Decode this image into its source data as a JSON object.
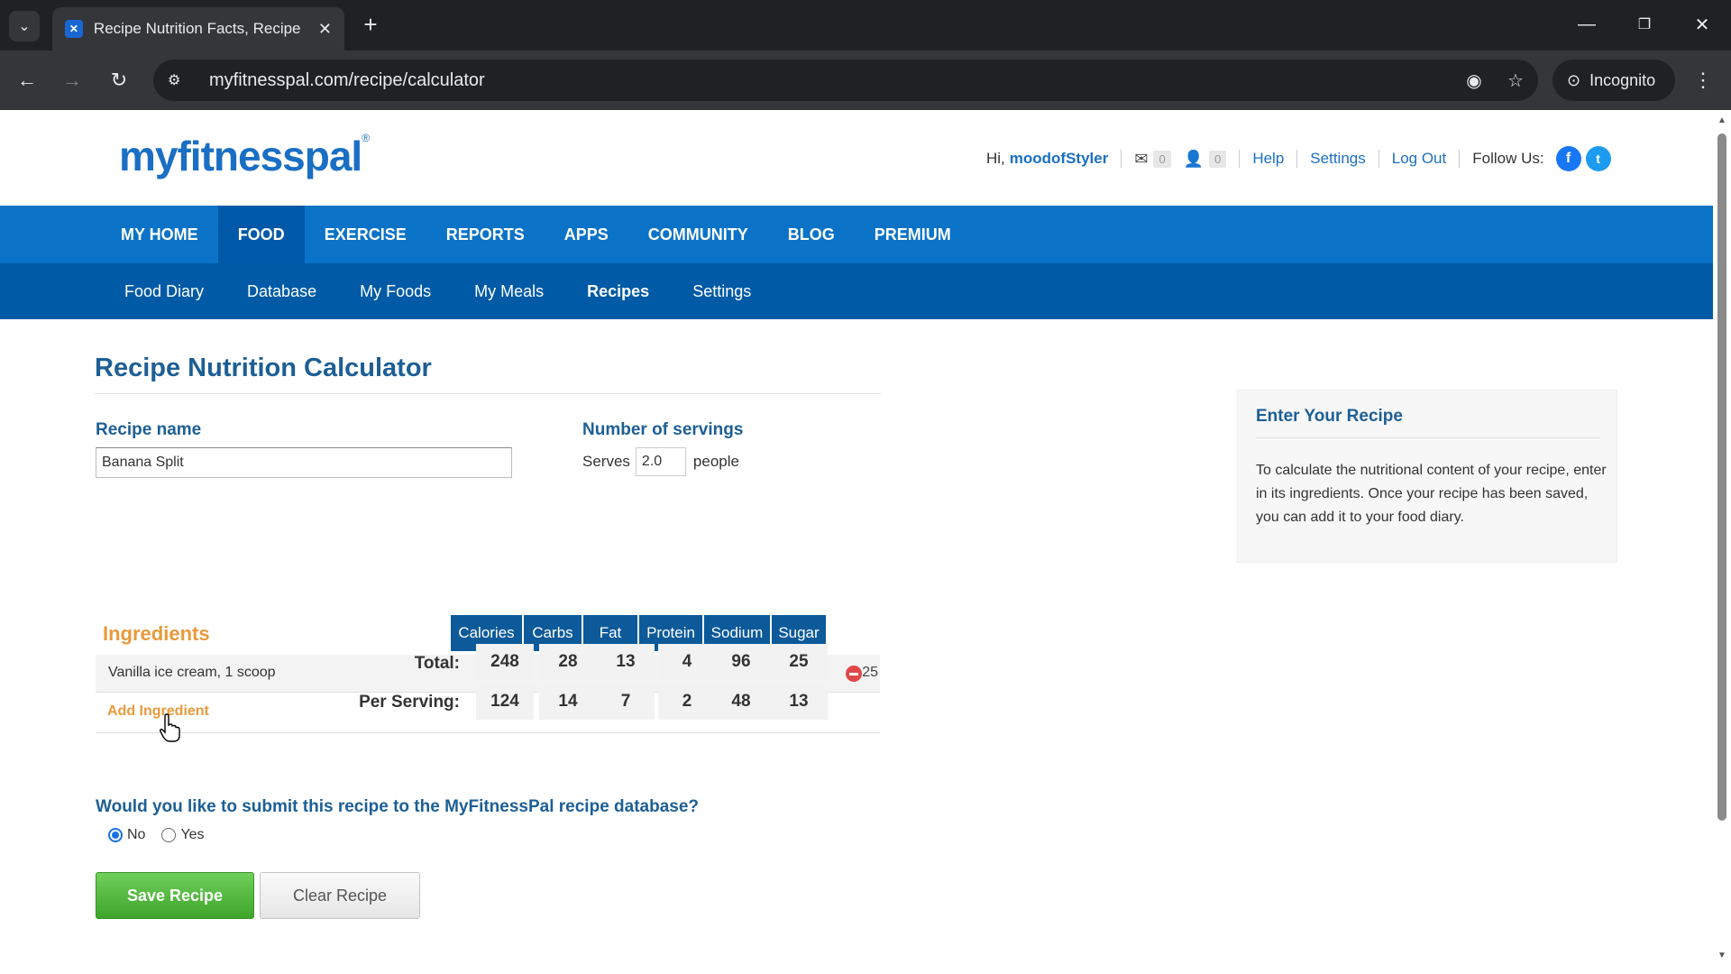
{
  "browser": {
    "tab_title": "Recipe Nutrition Facts, Recipe N",
    "url": "myfitnesspal.com/recipe/calculator",
    "incognito_label": "Incognito"
  },
  "header": {
    "logo": "myfitnesspal",
    "greeting": "Hi,",
    "username": "moodofStyler",
    "messages_count": "0",
    "friends_count": "0",
    "links": [
      "Help",
      "Settings",
      "Log Out"
    ],
    "follow_label": "Follow Us:",
    "facebook_glyph": "f",
    "twitter_glyph": "t"
  },
  "main_nav": {
    "items": [
      "MY HOME",
      "FOOD",
      "EXERCISE",
      "REPORTS",
      "APPS",
      "COMMUNITY",
      "BLOG",
      "PREMIUM"
    ],
    "active": "FOOD"
  },
  "sub_nav": {
    "items": [
      "Food Diary",
      "Database",
      "My Foods",
      "My Meals",
      "Recipes",
      "Settings"
    ],
    "active": "Recipes"
  },
  "calculator": {
    "title": "Recipe Nutrition Calculator",
    "recipe_name_label": "Recipe name",
    "recipe_name_value": "Banana Split",
    "servings_label": "Number of servings",
    "serves_prefix": "Serves",
    "servings_value": "2.0",
    "serves_suffix": "people",
    "ingredients_heading": "Ingredients",
    "columns": [
      "Calories",
      "Carbs",
      "Fat",
      "Protein",
      "Sodium",
      "Sugar"
    ],
    "ingredients": [
      {
        "name": "Vanilla ice cream, 1 scoop",
        "values": [
          "248",
          "28",
          "13",
          "4",
          "96",
          "25"
        ]
      }
    ],
    "add_ingredient": "Add Ingredient",
    "total_label": "Total:",
    "total_values": [
      "248",
      "28",
      "13",
      "4",
      "96",
      "25"
    ],
    "per_serving_label": "Per Serving:",
    "per_serving_values": [
      "124",
      "14",
      "7",
      "2",
      "48",
      "13"
    ],
    "submit_question": "Would you like to submit this recipe to the MyFitnessPal recipe database?",
    "radio_options": [
      "No",
      "Yes"
    ],
    "radio_selected": "No",
    "save_button": "Save Recipe",
    "clear_button": "Clear Recipe"
  },
  "sidebar": {
    "title": "Enter Your Recipe",
    "text": "To calculate the nutritional content of your recipe, enter in its ingredients. Once your recipe has been saved, you can add it to your food diary."
  },
  "colors": {
    "brand_blue": "#0a73c7",
    "subnav_blue": "#005aa6",
    "heading_blue": "#1d5f95",
    "accent_orange": "#e89a3c",
    "save_green": "#4bb335"
  }
}
